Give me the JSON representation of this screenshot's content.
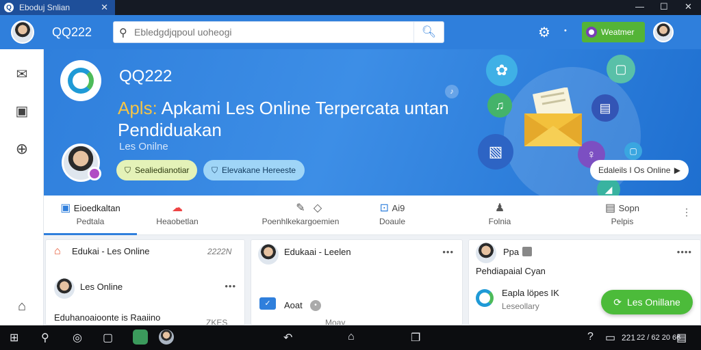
{
  "window": {
    "tab_title": "Eboduj Snlian",
    "close_glyph": "✕",
    "minimize": "—",
    "maximize": "☐",
    "close": "✕"
  },
  "topbar": {
    "brand": "QQ222",
    "search_placeholder": "Ebledgdjqpoul uoheogi",
    "welcome_label": "Weatmer"
  },
  "sidebar": {
    "items": [
      {
        "icon": "envelope-open-icon"
      },
      {
        "icon": "bookmark-icon"
      },
      {
        "icon": "plus-circle-icon"
      },
      {
        "icon": "home-icon"
      }
    ]
  },
  "hero": {
    "brand": "QQ222",
    "title_prefix": "Apls:",
    "title_rest": " Apkami Les Online Terpercata untan Pendiduakan",
    "subtitle": "Les Onilne",
    "pill_a": "Sealiedianotiar",
    "pill_b": "Elevakane Hereeste",
    "cta": "Edaleils I Os Online",
    "cta_arrow": "▶"
  },
  "tabs": [
    {
      "icon": "bookmark-icon",
      "title": "Eioedkaltan",
      "label": "Pedtala"
    },
    {
      "icon": "cloud-icon",
      "title": "",
      "label": "Heaobetlan"
    },
    {
      "icon": "pin-icon",
      "title": "",
      "label": "Poenhlkekargoemien"
    },
    {
      "icon": "tag-icon",
      "title": "",
      "label": ""
    },
    {
      "icon": "lock-icon",
      "title": "Ai9",
      "label": "Doaule"
    },
    {
      "icon": "user-icon",
      "title": "",
      "label": "Folnia"
    },
    {
      "icon": "folder-icon",
      "title": "Sopn",
      "label": "Pelpis"
    }
  ],
  "cards": {
    "c1": {
      "title": "Edukai - Les Online",
      "meta": "2222N",
      "post_name": "Les Online",
      "post_text": "Eduhanoaioonte is Raaiino",
      "post_meta": "ZKES"
    },
    "c2": {
      "title": "Edukaai - Leelen",
      "item": "Aoat",
      "foot": "Moay"
    },
    "c3": {
      "name": "Ppa",
      "line": "Pehdiapaial Cyan",
      "sub_title": "Eapla löpes IK",
      "sub_line": "Leseollary"
    }
  },
  "fab_label": "Les Onillane",
  "taskbar": {
    "time": "221",
    "date": "22 / 62 20 66"
  },
  "colors": {
    "primary": "#2f7fdc",
    "green": "#4cbb3a",
    "accent_yellow": "#f4c447"
  }
}
